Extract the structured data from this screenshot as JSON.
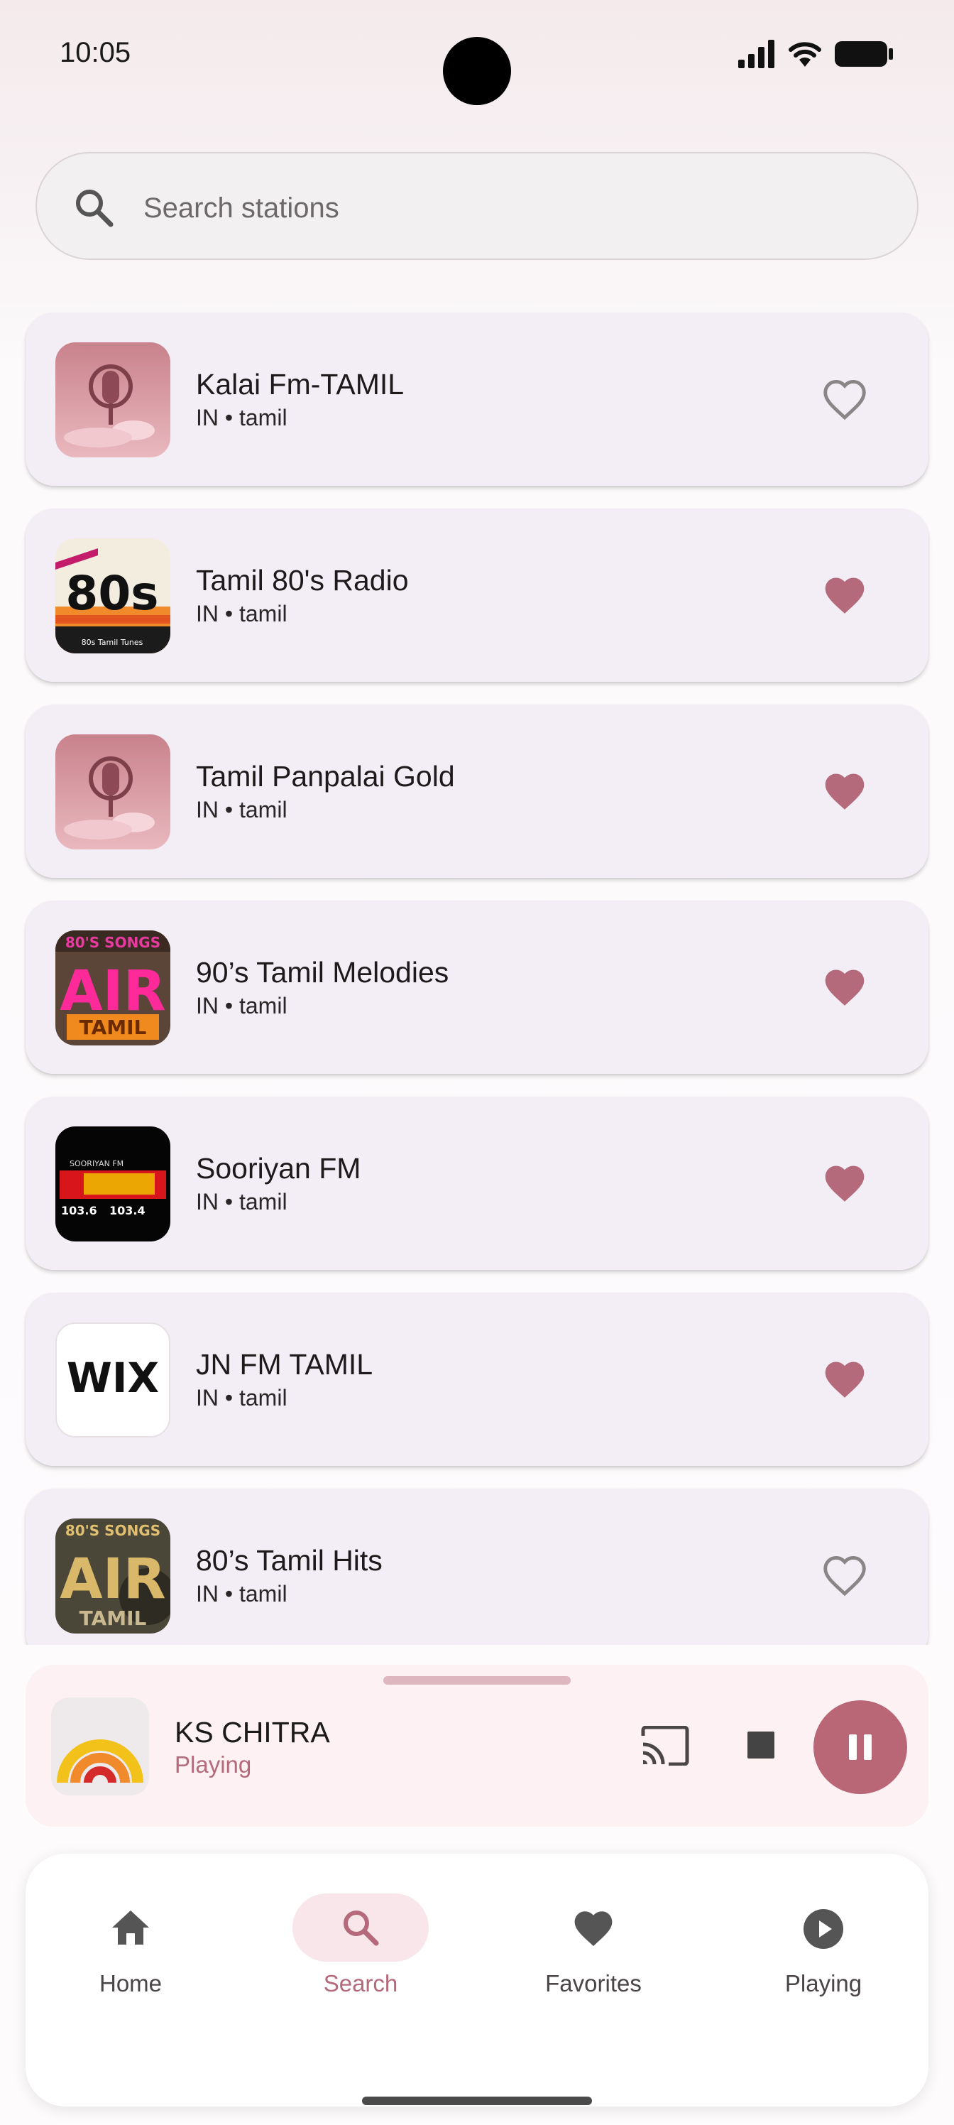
{
  "status_bar": {
    "time": "10:05"
  },
  "search": {
    "placeholder": "Search stations",
    "value": ""
  },
  "stations": [
    {
      "name": "Kalai Fm-TAMIL",
      "meta": "IN • tamil",
      "favorite": false
    },
    {
      "name": "Tamil 80's Radio",
      "meta": "IN • tamil",
      "favorite": true,
      "logo_text": "80s",
      "logo_caption": "80s Tamil Tunes"
    },
    {
      "name": "Tamil Panpalai Gold",
      "meta": "IN • tamil",
      "favorite": true
    },
    {
      "name": "90’s Tamil Melodies",
      "meta": "IN • tamil",
      "favorite": true,
      "logo_top": "80'S SONGS",
      "logo_main": "AIR",
      "logo_bottom": "TAMIL"
    },
    {
      "name": "Sooriyan FM",
      "meta": "IN • tamil",
      "favorite": true,
      "logo_top": "SOORIYAN FM",
      "logo_left": "103.6",
      "logo_right": "103.4"
    },
    {
      "name": "JN FM TAMIL",
      "meta": "IN • tamil",
      "favorite": true,
      "logo_text": "WIX"
    },
    {
      "name": "80’s Tamil Hits",
      "meta": "IN • tamil",
      "favorite": false,
      "logo_top": "80'S SONGS",
      "logo_main": "AIR",
      "logo_bottom": "TAMIL"
    }
  ],
  "now_playing": {
    "title": "KS CHITRA",
    "status": "Playing"
  },
  "nav": {
    "home": "Home",
    "search": "Search",
    "favorites": "Favorites",
    "playing": "Playing",
    "active": "search"
  },
  "colors": {
    "accent": "#b96676",
    "heart_filled": "#b56a7c",
    "card_bg": "#f3eef5",
    "player_bg": "#fdf1f3"
  }
}
